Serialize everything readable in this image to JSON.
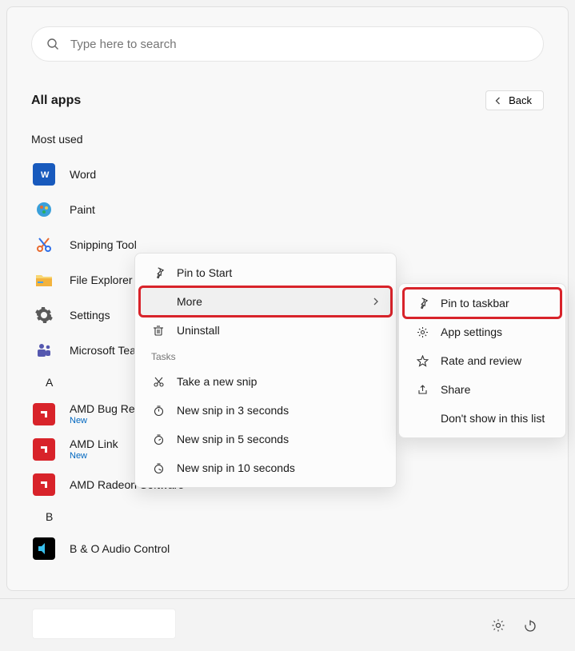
{
  "search": {
    "placeholder": "Type here to search"
  },
  "header": {
    "title": "All apps",
    "back": "Back"
  },
  "most_used_header": "Most used",
  "apps_most_used": [
    {
      "name": "Word"
    },
    {
      "name": "Paint"
    },
    {
      "name": "Snipping Tool"
    },
    {
      "name": "File Explorer"
    },
    {
      "name": "Settings"
    },
    {
      "name": "Microsoft Teams"
    }
  ],
  "letter_a": "A",
  "apps_a": [
    {
      "name": "AMD Bug Report Tool",
      "new": "New"
    },
    {
      "name": "AMD Link",
      "new": "New"
    },
    {
      "name": "AMD Radeon Software"
    }
  ],
  "letter_b": "B",
  "apps_b": [
    {
      "name": "B & O Audio Control"
    }
  ],
  "ctx1": {
    "pin_start": "Pin to Start",
    "more": "More",
    "uninstall": "Uninstall",
    "tasks_header": "Tasks",
    "tasks": [
      "Take a new snip",
      "New snip in 3 seconds",
      "New snip in 5 seconds",
      "New snip in 10 seconds"
    ]
  },
  "ctx2": {
    "pin_taskbar": "Pin to taskbar",
    "app_settings": "App settings",
    "rate": "Rate and review",
    "share": "Share",
    "dont_show": "Don't show in this list"
  }
}
